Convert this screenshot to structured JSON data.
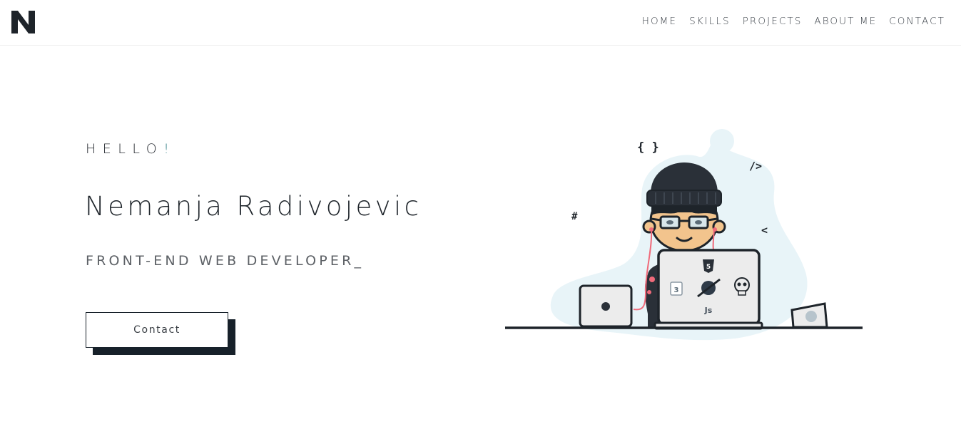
{
  "header": {
    "logo_letter": "N",
    "nav": [
      "HOME",
      "SKILLS",
      "PROJECTS",
      "ABOUT ME",
      "CONTACT"
    ]
  },
  "hero": {
    "greeting": "HELLO",
    "greeting_mark": "!",
    "name": "Nemanja Radivojevic",
    "role": "FRONT-END WEB DEVELOPER_",
    "contact_label": "Contact"
  },
  "illustration": {
    "symbols": [
      "{ }",
      "/>",
      "#",
      "<"
    ],
    "laptop_stickers": [
      "html5-icon",
      "css3-icon",
      "react-like-icon",
      "skull-icon",
      "Js"
    ],
    "js_label": "Js"
  },
  "colors": {
    "dark": "#1e242a",
    "accent": "#2f7d84",
    "blob": "#e8f4f8",
    "cable": "#f06a7a"
  }
}
